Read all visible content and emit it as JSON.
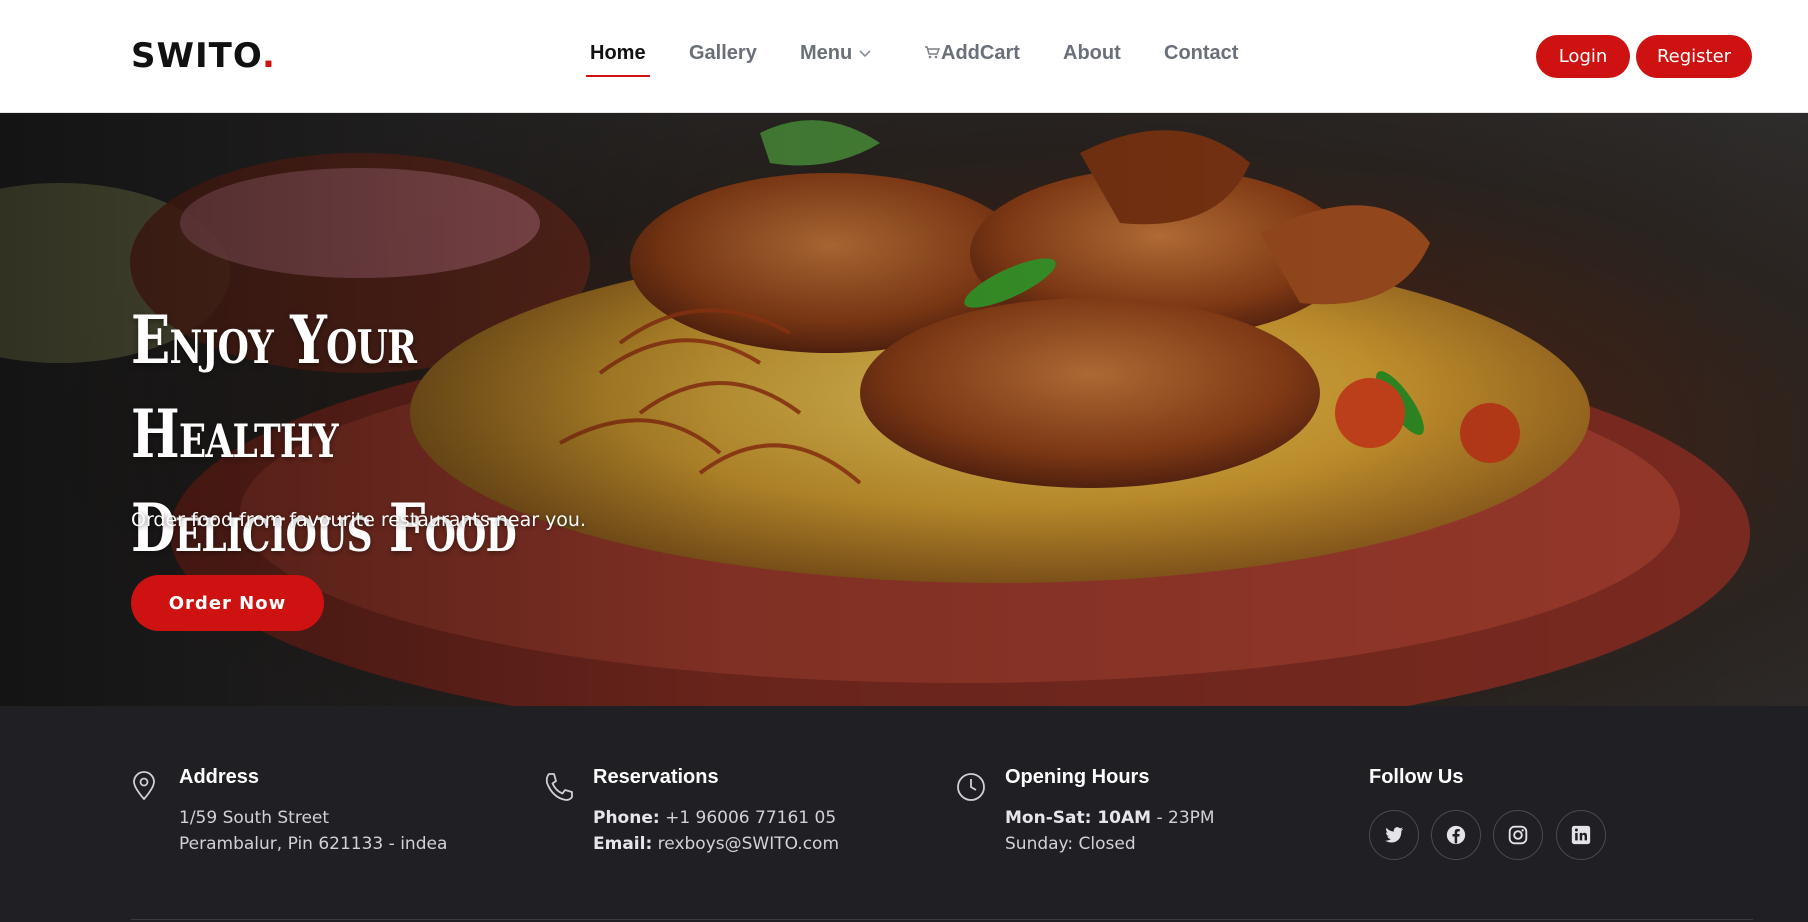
{
  "header": {
    "logo_text": "SWITO",
    "logo_dot": ".",
    "nav": {
      "home": "Home",
      "gallery": "Gallery",
      "menu": "Menu",
      "addcart": "AddCart",
      "about": "About",
      "contact": "Contact"
    },
    "login_label": "Login",
    "register_label": "Register"
  },
  "hero": {
    "title_line1": "Enjoy Your Healthy",
    "title_line2": "Delicious Food",
    "subtitle": "Order food from favourite restaurants near you.",
    "cta_label": "Order Now"
  },
  "footer": {
    "address": {
      "heading": "Address",
      "line1": "1/59 South Street",
      "line2": "Perambalur, Pin 621133 - indea"
    },
    "reservations": {
      "heading": "Reservations",
      "phone_label": "Phone:",
      "phone_value": " +1 96006 77161 05",
      "email_label": "Email:",
      "email_value": " rexboys@SWITO.com"
    },
    "hours": {
      "heading": "Opening Hours",
      "weekday_label": "Mon-Sat:",
      "weekday_start": " 10AM",
      "weekday_end": " - 23PM",
      "sunday": "Sunday: Closed"
    },
    "follow": {
      "heading": "Follow Us",
      "icons": [
        "twitter-icon",
        "facebook-icon",
        "instagram-icon",
        "linkedin-icon"
      ]
    }
  },
  "colors": {
    "accent": "#ce1212",
    "footer_bg": "#1f1f24",
    "header_bg": "#ffffff"
  }
}
